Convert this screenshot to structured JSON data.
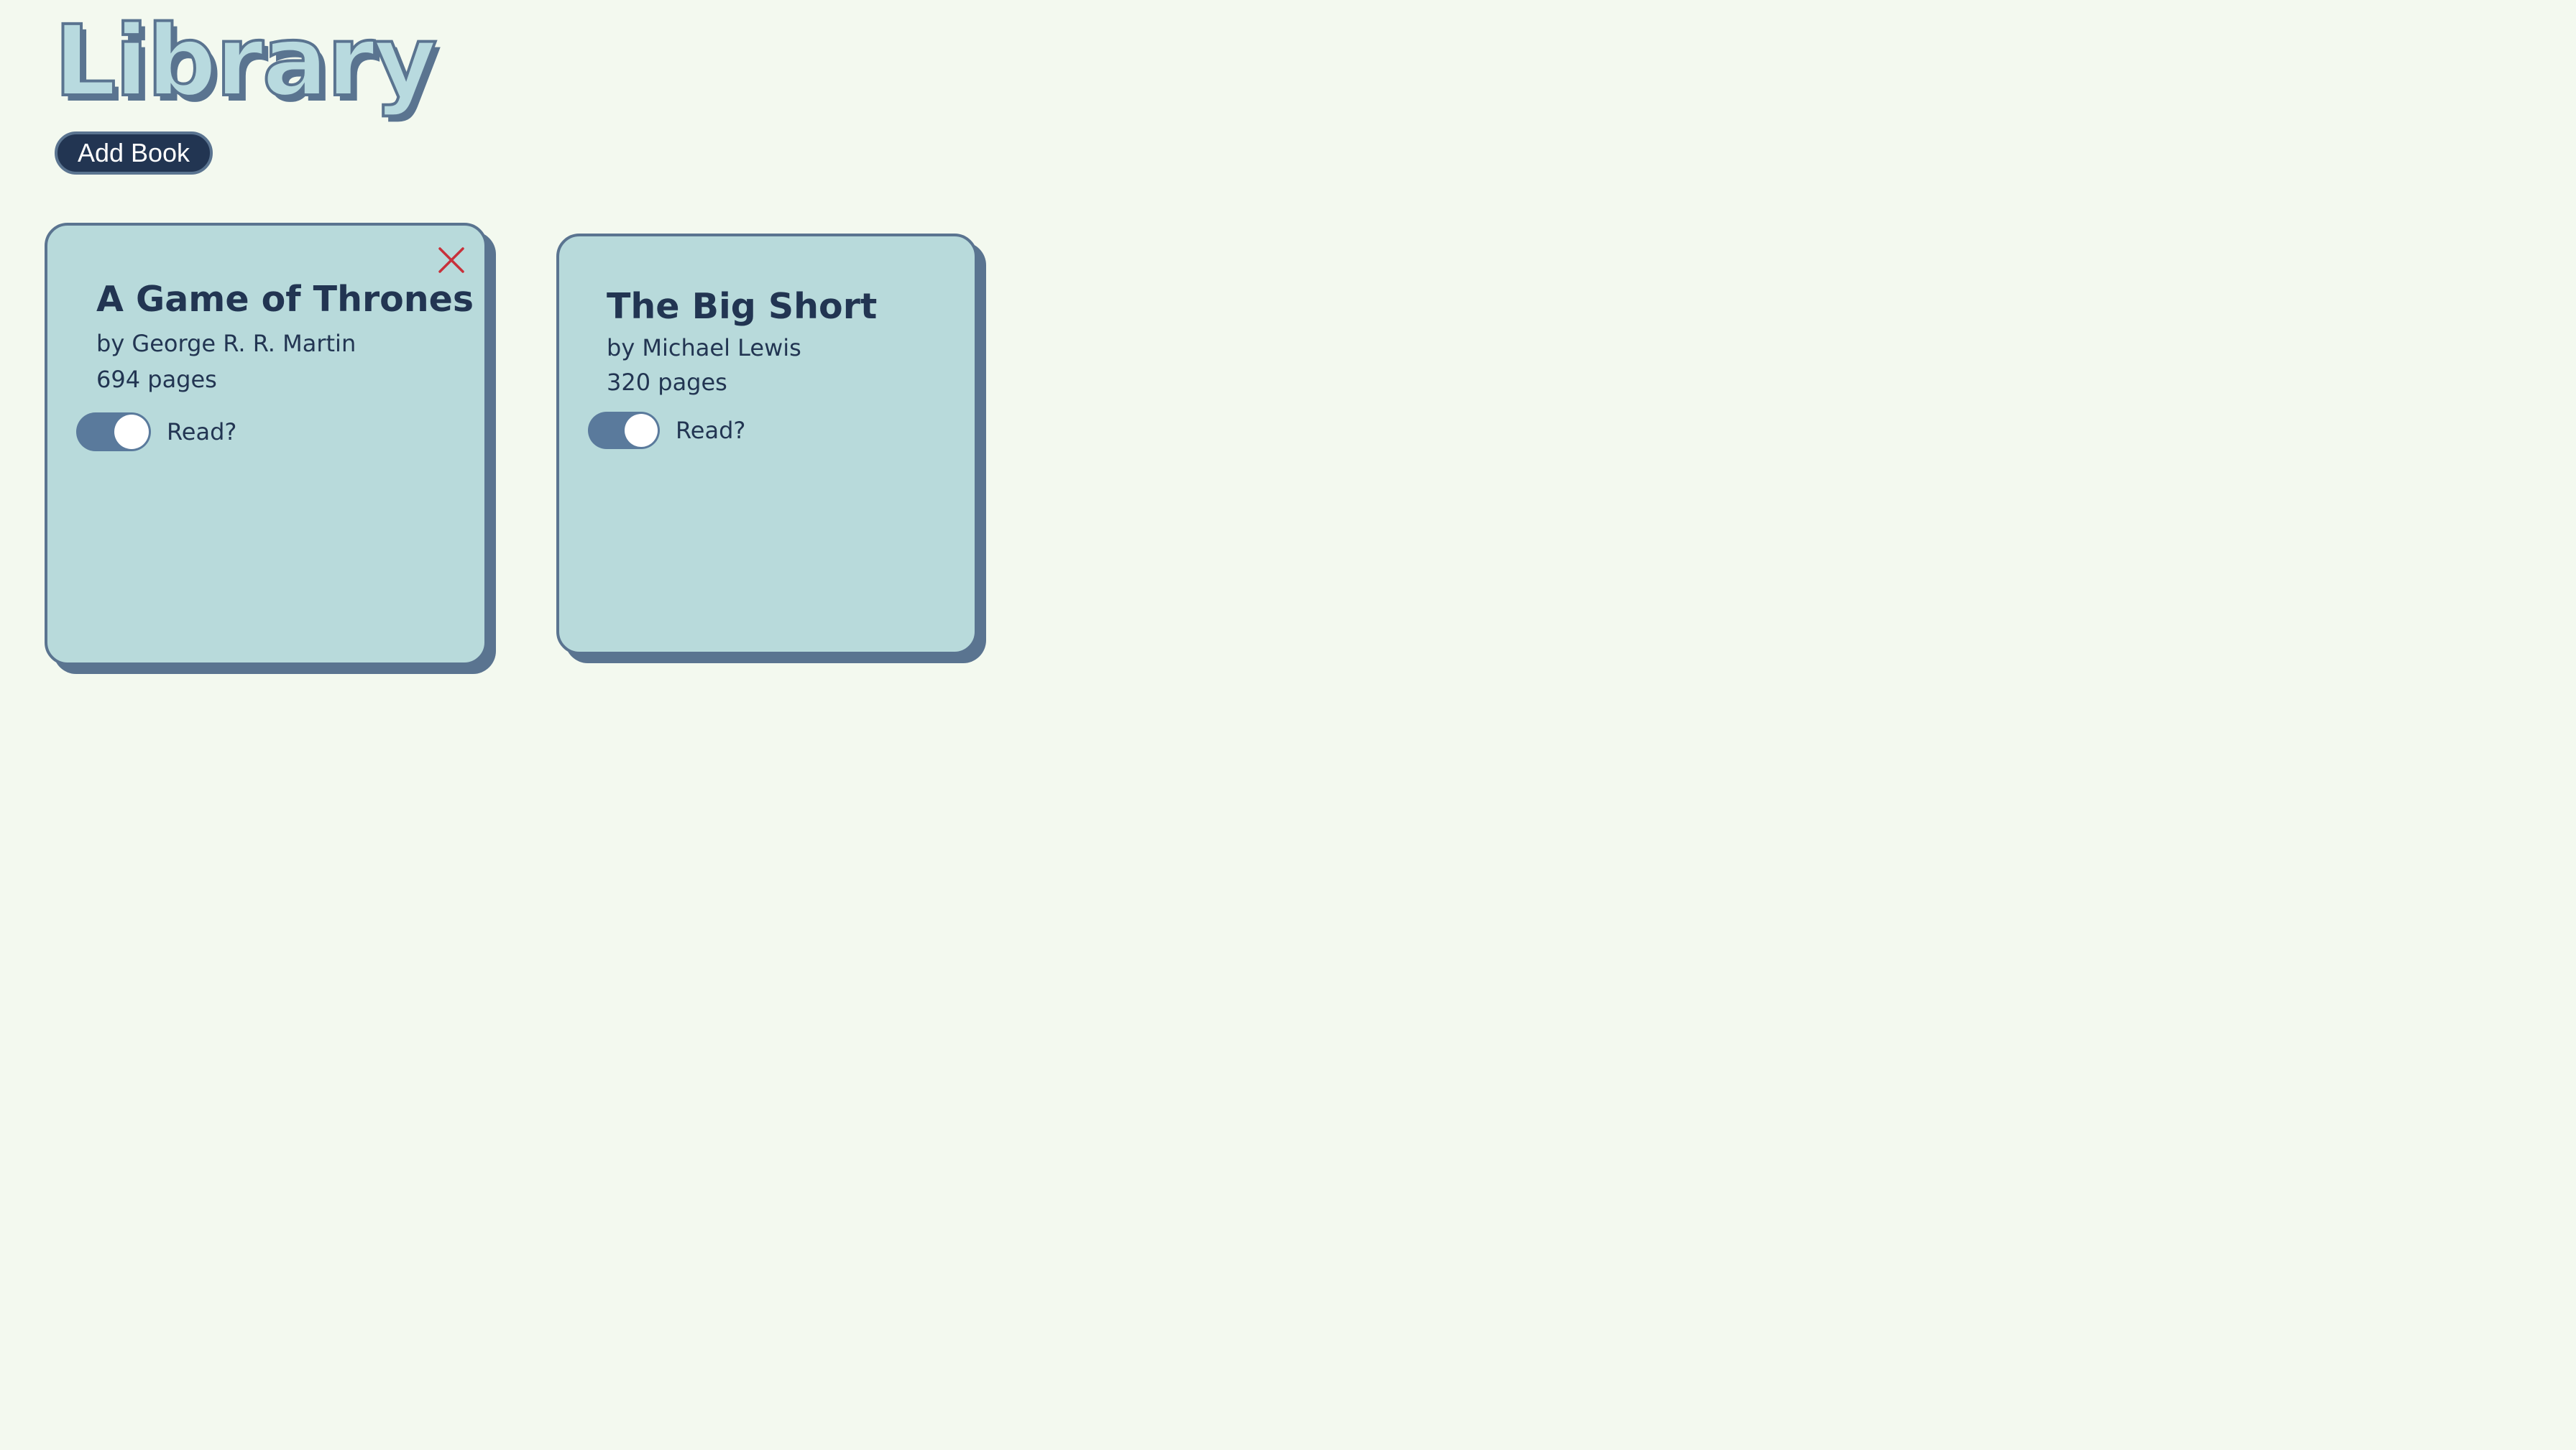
{
  "header": {
    "title": "Library",
    "add_book_label": "Add Book"
  },
  "colors": {
    "background": "#f3f9ef",
    "card_fill": "#b8dadb",
    "card_border": "#5a7490",
    "text": "#223552",
    "button_fill": "#223552",
    "toggle_on": "#5a7a9c",
    "delete": "#c8303a"
  },
  "books": [
    {
      "title": "A Game of Thrones",
      "author": "by George R. R. Martin",
      "pages": "694 pages",
      "read_label": "Read?",
      "read": true,
      "delete_icon": "close-icon"
    },
    {
      "title": "The Big Short",
      "author": "by Michael Lewis",
      "pages": "320 pages",
      "read_label": "Read?",
      "read": true
    }
  ]
}
